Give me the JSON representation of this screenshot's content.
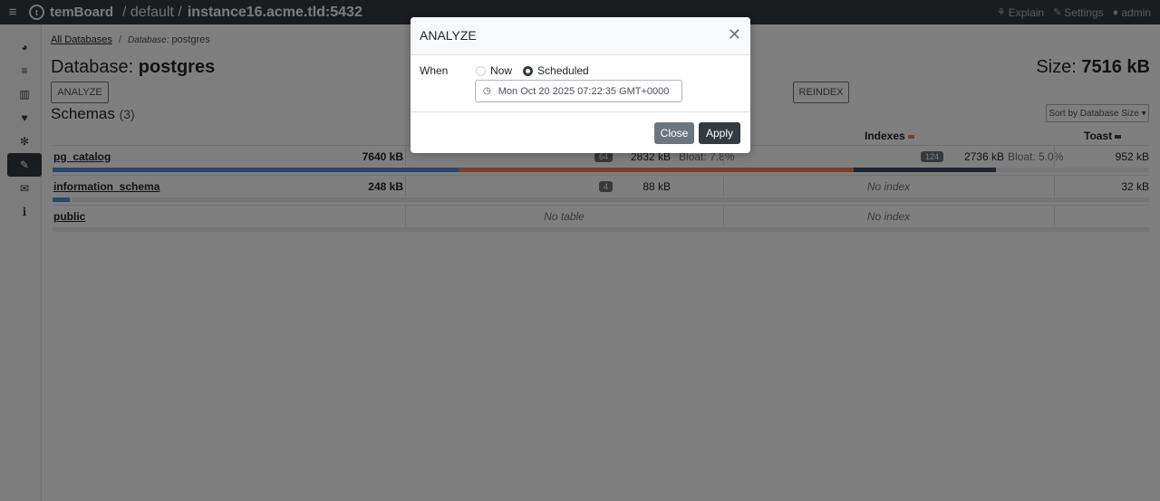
{
  "navbar": {
    "brand": "temBoard",
    "env": "/ default /",
    "instance": "instance16.acme.tld:5432",
    "explain": "Explain",
    "settings": "Settings",
    "user": "admin"
  },
  "sidebar": {
    "items": [
      {
        "icon": "dashboard-icon",
        "glyph": "◕"
      },
      {
        "icon": "list-icon",
        "glyph": "≡"
      },
      {
        "icon": "chart-icon",
        "glyph": "▥"
      },
      {
        "icon": "heart-icon",
        "glyph": "♥"
      },
      {
        "icon": "gear-icon",
        "glyph": "✻"
      },
      {
        "icon": "wrench-icon",
        "glyph": "✎",
        "active": true
      },
      {
        "icon": "envelope-icon",
        "glyph": "✉"
      },
      {
        "icon": "info-icon",
        "glyph": "i"
      }
    ]
  },
  "breadcrumb": {
    "all_databases": "All Databases",
    "sep": "/",
    "current_label": "Database:",
    "current": "postgres"
  },
  "database": {
    "title_prefix": "Database:",
    "name": "postgres",
    "size_label": "Size:",
    "size_value": "7516 kB"
  },
  "actions": {
    "analyze": "ANALYZE",
    "reindex": "REINDEX"
  },
  "schemas": {
    "title": "Schemas",
    "count": "(3)",
    "sort_label": "Sort by Database Size ▾",
    "columns": {
      "indexes": "Indexes",
      "toast": "Toast"
    },
    "rows": [
      {
        "name": "pg_catalog",
        "size": "7640 kB",
        "tables_count": "64",
        "tables_size": "2832 kB",
        "tables_bloat": "Bloat: 7.8%",
        "indexes_count": "124",
        "indexes_size": "2736 kB",
        "indexes_bloat": "Bloat: 5.0%",
        "toast_size": "952 kB",
        "bar_tables_fraction": 0.37,
        "bar_indexes_fraction": 0.36,
        "bar_toast_fraction": 0.13
      },
      {
        "name": "information_schema",
        "size": "248 kB",
        "tables_count": "4",
        "tables_size": "88 kB",
        "no_index": "No index",
        "toast_size": "32 kB",
        "bar_fraction": 0.016
      },
      {
        "name": "public",
        "no_table": "No table",
        "no_index": "No index"
      }
    ]
  },
  "colors": {
    "tables_bar": "#5a8fd8",
    "indexes_bar": "#e8825f",
    "toast_bar": "#3c4a63",
    "navbar_bg": "#343a40",
    "btn_dark": "#343a40",
    "btn_secondary": "#6c757d"
  },
  "modal": {
    "title": "ANALYZE",
    "when_label": "When",
    "option_now": "Now",
    "option_scheduled": "Scheduled",
    "selected": "Scheduled",
    "datetime_value": "Mon Oct 20 2025 07:22:35 GMT+0000",
    "close": "Close",
    "apply": "Apply"
  }
}
